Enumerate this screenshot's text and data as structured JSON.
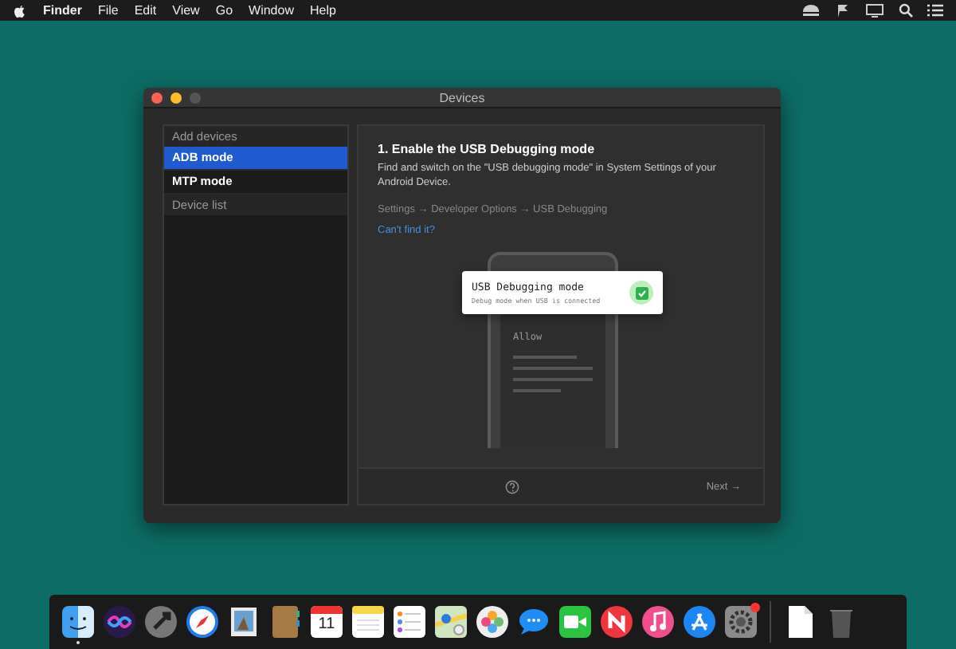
{
  "menubar": {
    "app": "Finder",
    "items": [
      "File",
      "Edit",
      "View",
      "Go",
      "Window",
      "Help"
    ]
  },
  "window": {
    "title": "Devices"
  },
  "sidebar": {
    "items": [
      {
        "kind": "header",
        "label": "Add devices"
      },
      {
        "kind": "item",
        "label": "ADB mode",
        "selected": true
      },
      {
        "kind": "item",
        "label": "MTP mode",
        "selected": false
      },
      {
        "kind": "header",
        "label": "Device list"
      }
    ]
  },
  "guide": {
    "heading": "1. Enable the USB Debugging mode",
    "description": "Find and switch on the \"USB debugging mode\" in System Settings of your Android Device.",
    "path": "Settings → Developer Options → USB Debugging",
    "link": "Can't find it?",
    "phone": {
      "prompt": "Allow"
    },
    "setting_card": {
      "title": "USB Debugging mode",
      "subtitle": "Debug mode when USB is connected",
      "checked": true
    },
    "next_button": "Next →"
  },
  "dock": [
    {
      "kind": "finder",
      "running": true
    },
    {
      "kind": "siri",
      "running": false
    },
    {
      "kind": "launchpad",
      "running": false
    },
    {
      "kind": "safari",
      "running": false
    },
    {
      "kind": "preview",
      "running": false
    },
    {
      "kind": "contacts",
      "running": false
    },
    {
      "kind": "calendar",
      "date": "11",
      "running": false
    },
    {
      "kind": "notes",
      "running": false
    },
    {
      "kind": "reminders",
      "running": false
    },
    {
      "kind": "maps",
      "running": false
    },
    {
      "kind": "photos",
      "running": false
    },
    {
      "kind": "messages",
      "running": false
    },
    {
      "kind": "facetime",
      "running": false
    },
    {
      "kind": "news",
      "running": false
    },
    {
      "kind": "music",
      "running": false
    },
    {
      "kind": "appstore",
      "running": false
    },
    {
      "kind": "settings",
      "running": false,
      "badge": true
    },
    {
      "kind": "separator"
    },
    {
      "kind": "document",
      "running": false
    },
    {
      "kind": "trash",
      "running": false
    }
  ]
}
